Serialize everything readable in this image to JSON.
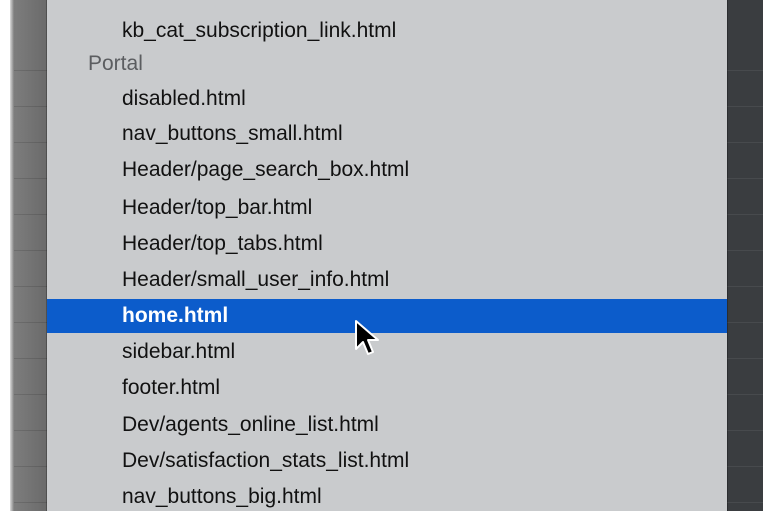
{
  "menu": {
    "rows": [
      {
        "kind": "item",
        "label": "kb_cat_subscription_link.html"
      },
      {
        "kind": "section",
        "label": "Portal"
      },
      {
        "kind": "item",
        "label": "disabled.html"
      },
      {
        "kind": "item",
        "label": "nav_buttons_small.html"
      },
      {
        "kind": "item",
        "label": "Header/page_search_box.html"
      },
      {
        "kind": "item",
        "label": "Header/top_bar.html"
      },
      {
        "kind": "item",
        "label": "Header/top_tabs.html"
      },
      {
        "kind": "item",
        "label": "Header/small_user_info.html"
      },
      {
        "kind": "item",
        "label": "home.html",
        "selected": true
      },
      {
        "kind": "item",
        "label": "sidebar.html"
      },
      {
        "kind": "item",
        "label": "footer.html"
      },
      {
        "kind": "item",
        "label": "Dev/agents_online_list.html"
      },
      {
        "kind": "item",
        "label": "Dev/satisfaction_stats_list.html"
      },
      {
        "kind": "item",
        "label": "nav_buttons_big.html"
      }
    ]
  },
  "colors": {
    "menu_background": "#c9cbcd",
    "selection": "#0c5ccb",
    "section_header_text": "#5b5d60",
    "editor_background": "#3a3d40"
  },
  "icons": {
    "pointer": "mouse-pointer-icon"
  }
}
